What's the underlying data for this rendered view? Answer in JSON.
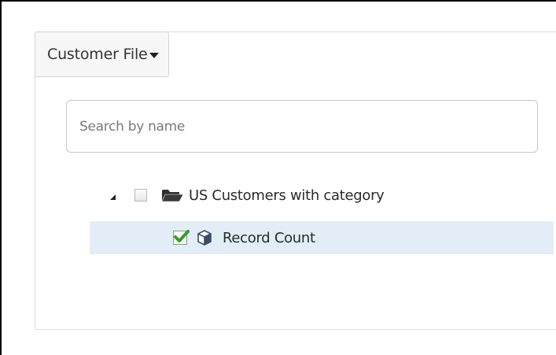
{
  "file_menu": {
    "label": "Customer File"
  },
  "search": {
    "placeholder": "Search by name",
    "value": ""
  },
  "tree": {
    "items": [
      {
        "label": "US Customers with category",
        "type": "folder",
        "expanded": true,
        "checked": false,
        "icon": "folder-open-icon"
      },
      {
        "label": "Record Count",
        "type": "measure",
        "checked": true,
        "selected": true,
        "icon": "cube-icon"
      }
    ]
  },
  "colors": {
    "selected_row": "#e3edf7",
    "check_green": "#3a9a2e",
    "text": "#2a2a2a"
  }
}
